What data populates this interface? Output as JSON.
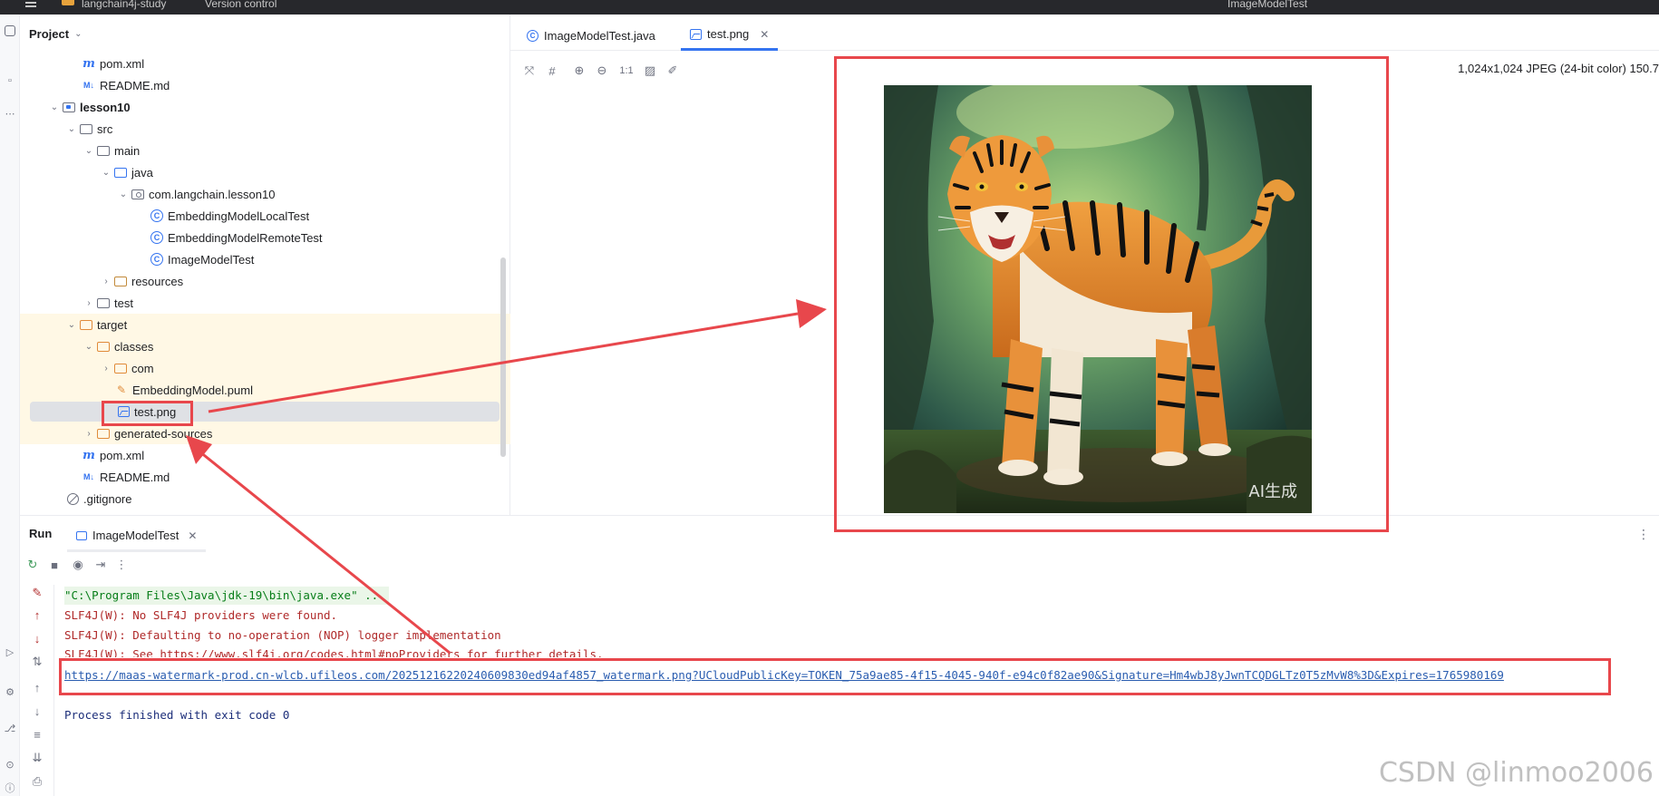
{
  "titlebar": {
    "project_name": "langchain4j-study",
    "vcs_label": "Version control",
    "run_config": "ImageModelTest"
  },
  "project_panel": {
    "title": "Project",
    "rows": [
      {
        "label": "pom.xml",
        "icon": "maven-icon"
      },
      {
        "label": "README.md",
        "icon": "markdown-icon"
      },
      {
        "label": "lesson10",
        "icon": "module-folder-icon"
      },
      {
        "label": "src",
        "icon": "folder-icon"
      },
      {
        "label": "main",
        "icon": "folder-icon"
      },
      {
        "label": "java",
        "icon": "source-folder-icon"
      },
      {
        "label": "com.langchain.lesson10",
        "icon": "package-icon"
      },
      {
        "label": "EmbeddingModelLocalTest",
        "icon": "class-icon"
      },
      {
        "label": "EmbeddingModelRemoteTest",
        "icon": "class-icon"
      },
      {
        "label": "ImageModelTest",
        "icon": "class-icon"
      },
      {
        "label": "resources",
        "icon": "resources-folder-icon"
      },
      {
        "label": "test",
        "icon": "folder-icon"
      },
      {
        "label": "target",
        "icon": "excluded-folder-icon"
      },
      {
        "label": "classes",
        "icon": "excluded-folder-icon"
      },
      {
        "label": "com",
        "icon": "excluded-folder-icon"
      },
      {
        "label": "EmbeddingModel.puml",
        "icon": "plantuml-icon"
      },
      {
        "label": "test.png",
        "icon": "image-icon"
      },
      {
        "label": "generated-sources",
        "icon": "excluded-folder-icon"
      },
      {
        "label": "pom.xml",
        "icon": "maven-icon"
      },
      {
        "label": "README.md",
        "icon": "markdown-icon"
      },
      {
        "label": ".gitignore",
        "icon": "ignore-icon"
      }
    ]
  },
  "editor": {
    "tabs": [
      {
        "label": "ImageModelTest.java",
        "icon": "class-icon",
        "active": false
      },
      {
        "label": "test.png",
        "icon": "image-icon",
        "active": true
      }
    ],
    "image_info": "1,024x1,024 JPEG (24-bit color) 150.7",
    "zoom_actual": "1:1",
    "image_watermark": "AI生成"
  },
  "run_panel": {
    "title": "Run",
    "tab_label": "ImageModelTest",
    "console": [
      {
        "kind": "cmd",
        "text": "\"C:\\Program Files\\Java\\jdk-19\\bin\\java.exe\" ..."
      },
      {
        "kind": "err",
        "text": "SLF4J(W): No SLF4J providers were found."
      },
      {
        "kind": "err",
        "text": "SLF4J(W): Defaulting to no-operation (NOP) logger implementation"
      },
      {
        "kind": "err",
        "text": "SLF4J(W): See https://www.slf4j.org/codes.html#noProviders for further details."
      },
      {
        "kind": "link",
        "text": "https://maas-watermark-prod.cn-wlcb.ufileos.com/20251216220240609830ed94af4857_watermark.png?UCloudPublicKey=TOKEN_75a9ae85-4f15-4045-940f-e94c0f82ae90&Signature=Hm4wbJ8yJwnTCQDGLTz0T5zMvW8%3D&Expires=1765980169"
      },
      {
        "kind": "exit",
        "text": "Process finished with exit code 0"
      }
    ]
  },
  "page_watermark": "CSDN @linmoo2006",
  "colors": {
    "accent": "#3574f0",
    "annotation_red": "#e8474c",
    "excluded_bg": "#fff8e5",
    "error_text": "#b02a2a"
  }
}
